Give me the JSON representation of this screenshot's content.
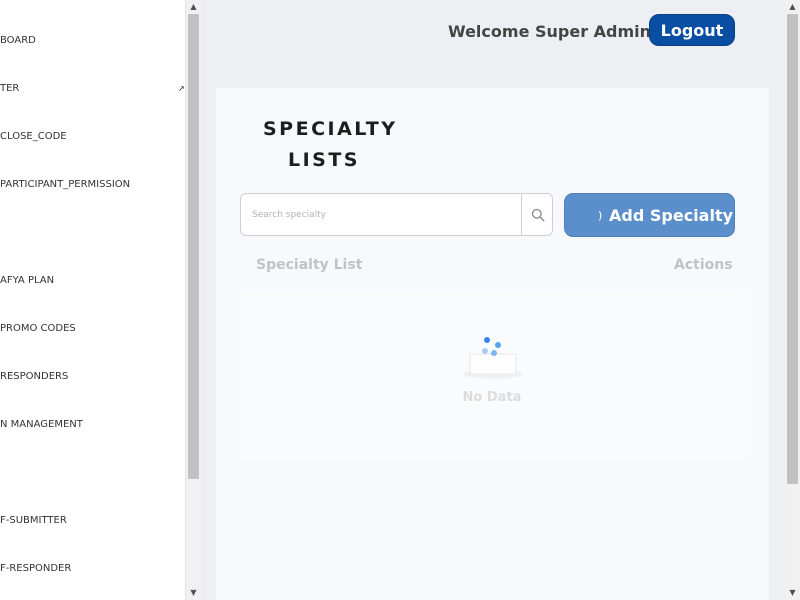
{
  "sidebar": {
    "items": [
      {
        "label": "BOARD"
      },
      {
        "label": "TER"
      },
      {
        "label": "CLOSE_CODE"
      },
      {
        "label": "PARTICIPANT_PERMISSION"
      },
      {
        "label": "AFYA PLAN"
      },
      {
        "label": "PROMO CODES"
      },
      {
        "label": "RESPONDERS"
      },
      {
        "label": "N MANAGEMENT"
      },
      {
        "label": "F-SUBMITTER"
      },
      {
        "label": "F-RESPONDER"
      }
    ]
  },
  "header": {
    "welcome": "Welcome Super Admin",
    "logout_label": "Logout"
  },
  "main": {
    "title_line1": "SPECIALTY",
    "title_line2": "LISTS",
    "search_placeholder": "Search specialty",
    "search_value": "",
    "add_button_label": "Add Specialty",
    "add_button_spinner": ")",
    "table": {
      "columns": [
        "Specialty List",
        "Actions"
      ],
      "empty_text": "No Data"
    }
  },
  "colors": {
    "logout_bg": "#0a4ea3",
    "add_button_bg": "#5b8fcb",
    "loader_blue": "#3b8ff5"
  },
  "icons": {
    "search": "search-icon",
    "caret": "expand-arrow-icon",
    "empty": "empty-box-icon"
  }
}
